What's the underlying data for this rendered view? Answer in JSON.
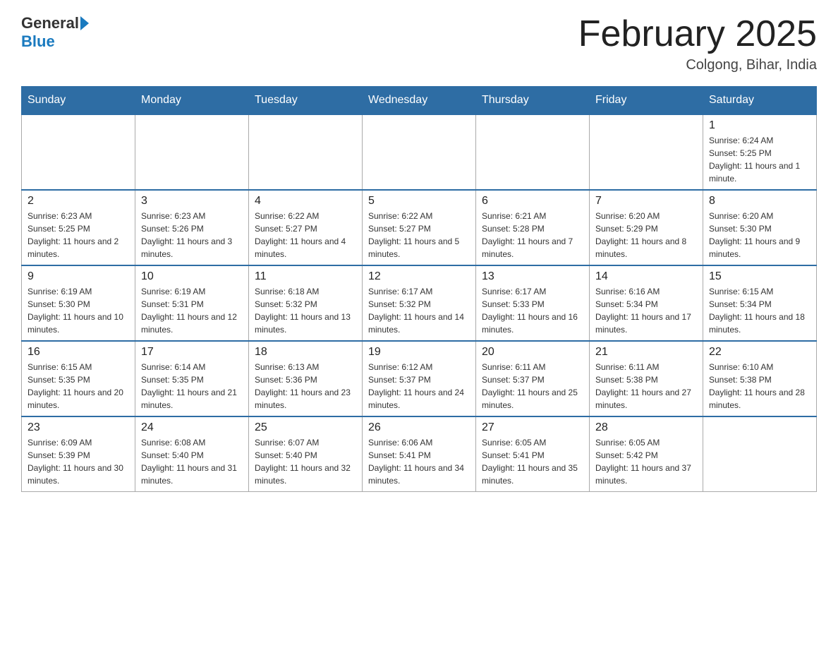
{
  "logo": {
    "general": "General",
    "blue": "Blue"
  },
  "title": "February 2025",
  "location": "Colgong, Bihar, India",
  "days_of_week": [
    "Sunday",
    "Monday",
    "Tuesday",
    "Wednesday",
    "Thursday",
    "Friday",
    "Saturday"
  ],
  "weeks": [
    [
      {
        "day": "",
        "info": ""
      },
      {
        "day": "",
        "info": ""
      },
      {
        "day": "",
        "info": ""
      },
      {
        "day": "",
        "info": ""
      },
      {
        "day": "",
        "info": ""
      },
      {
        "day": "",
        "info": ""
      },
      {
        "day": "1",
        "info": "Sunrise: 6:24 AM\nSunset: 5:25 PM\nDaylight: 11 hours and 1 minute."
      }
    ],
    [
      {
        "day": "2",
        "info": "Sunrise: 6:23 AM\nSunset: 5:25 PM\nDaylight: 11 hours and 2 minutes."
      },
      {
        "day": "3",
        "info": "Sunrise: 6:23 AM\nSunset: 5:26 PM\nDaylight: 11 hours and 3 minutes."
      },
      {
        "day": "4",
        "info": "Sunrise: 6:22 AM\nSunset: 5:27 PM\nDaylight: 11 hours and 4 minutes."
      },
      {
        "day": "5",
        "info": "Sunrise: 6:22 AM\nSunset: 5:27 PM\nDaylight: 11 hours and 5 minutes."
      },
      {
        "day": "6",
        "info": "Sunrise: 6:21 AM\nSunset: 5:28 PM\nDaylight: 11 hours and 7 minutes."
      },
      {
        "day": "7",
        "info": "Sunrise: 6:20 AM\nSunset: 5:29 PM\nDaylight: 11 hours and 8 minutes."
      },
      {
        "day": "8",
        "info": "Sunrise: 6:20 AM\nSunset: 5:30 PM\nDaylight: 11 hours and 9 minutes."
      }
    ],
    [
      {
        "day": "9",
        "info": "Sunrise: 6:19 AM\nSunset: 5:30 PM\nDaylight: 11 hours and 10 minutes."
      },
      {
        "day": "10",
        "info": "Sunrise: 6:19 AM\nSunset: 5:31 PM\nDaylight: 11 hours and 12 minutes."
      },
      {
        "day": "11",
        "info": "Sunrise: 6:18 AM\nSunset: 5:32 PM\nDaylight: 11 hours and 13 minutes."
      },
      {
        "day": "12",
        "info": "Sunrise: 6:17 AM\nSunset: 5:32 PM\nDaylight: 11 hours and 14 minutes."
      },
      {
        "day": "13",
        "info": "Sunrise: 6:17 AM\nSunset: 5:33 PM\nDaylight: 11 hours and 16 minutes."
      },
      {
        "day": "14",
        "info": "Sunrise: 6:16 AM\nSunset: 5:34 PM\nDaylight: 11 hours and 17 minutes."
      },
      {
        "day": "15",
        "info": "Sunrise: 6:15 AM\nSunset: 5:34 PM\nDaylight: 11 hours and 18 minutes."
      }
    ],
    [
      {
        "day": "16",
        "info": "Sunrise: 6:15 AM\nSunset: 5:35 PM\nDaylight: 11 hours and 20 minutes."
      },
      {
        "day": "17",
        "info": "Sunrise: 6:14 AM\nSunset: 5:35 PM\nDaylight: 11 hours and 21 minutes."
      },
      {
        "day": "18",
        "info": "Sunrise: 6:13 AM\nSunset: 5:36 PM\nDaylight: 11 hours and 23 minutes."
      },
      {
        "day": "19",
        "info": "Sunrise: 6:12 AM\nSunset: 5:37 PM\nDaylight: 11 hours and 24 minutes."
      },
      {
        "day": "20",
        "info": "Sunrise: 6:11 AM\nSunset: 5:37 PM\nDaylight: 11 hours and 25 minutes."
      },
      {
        "day": "21",
        "info": "Sunrise: 6:11 AM\nSunset: 5:38 PM\nDaylight: 11 hours and 27 minutes."
      },
      {
        "day": "22",
        "info": "Sunrise: 6:10 AM\nSunset: 5:38 PM\nDaylight: 11 hours and 28 minutes."
      }
    ],
    [
      {
        "day": "23",
        "info": "Sunrise: 6:09 AM\nSunset: 5:39 PM\nDaylight: 11 hours and 30 minutes."
      },
      {
        "day": "24",
        "info": "Sunrise: 6:08 AM\nSunset: 5:40 PM\nDaylight: 11 hours and 31 minutes."
      },
      {
        "day": "25",
        "info": "Sunrise: 6:07 AM\nSunset: 5:40 PM\nDaylight: 11 hours and 32 minutes."
      },
      {
        "day": "26",
        "info": "Sunrise: 6:06 AM\nSunset: 5:41 PM\nDaylight: 11 hours and 34 minutes."
      },
      {
        "day": "27",
        "info": "Sunrise: 6:05 AM\nSunset: 5:41 PM\nDaylight: 11 hours and 35 minutes."
      },
      {
        "day": "28",
        "info": "Sunrise: 6:05 AM\nSunset: 5:42 PM\nDaylight: 11 hours and 37 minutes."
      },
      {
        "day": "",
        "info": ""
      }
    ]
  ]
}
